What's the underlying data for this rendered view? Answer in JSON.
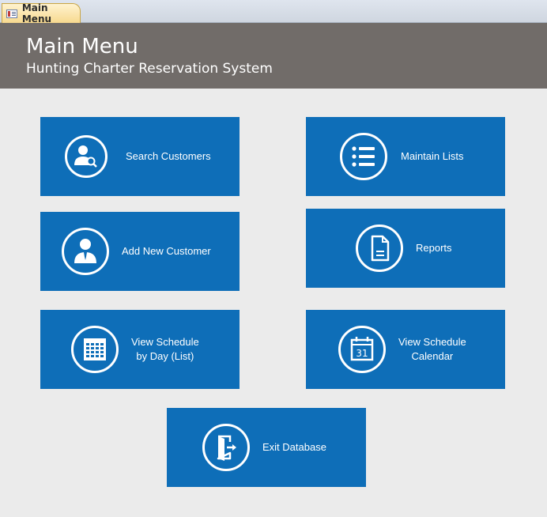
{
  "window": {
    "tab_label": "Main Menu"
  },
  "header": {
    "title": "Main Menu",
    "subtitle": "Hunting Charter Reservation System"
  },
  "buttons": {
    "search_customers": "Search Customers",
    "maintain_lists": "Maintain Lists",
    "add_new_customer": "Add New Customer",
    "reports": "Reports",
    "view_schedule_day": "View Schedule\nby Day (List)",
    "view_schedule_calendar": "View Schedule\nCalendar",
    "exit_database": "Exit Database",
    "calendar_day": "31"
  },
  "colors": {
    "header_bg": "#716c69",
    "button_bg": "#0e6eb8",
    "page_bg": "#ebebeb",
    "tab_bg": "#f7d98f"
  },
  "icons": {
    "search_customers": "user-search-icon",
    "maintain_lists": "list-icon",
    "add_new_customer": "user-icon",
    "reports": "document-icon",
    "view_schedule_day": "calendar-grid-icon",
    "view_schedule_calendar": "calendar-icon",
    "exit_database": "exit-door-icon"
  }
}
